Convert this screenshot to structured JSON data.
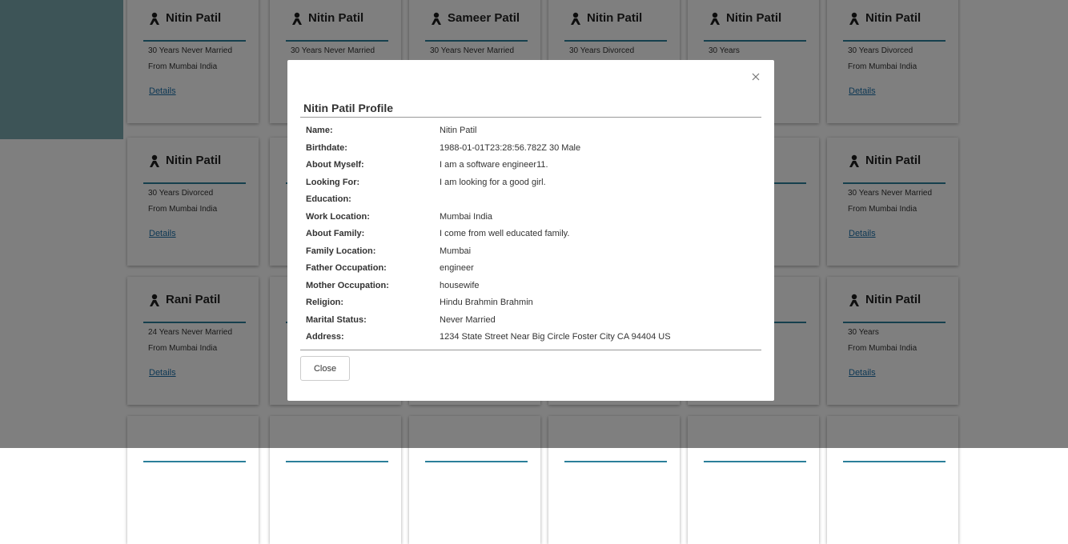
{
  "cards": [
    {
      "name": "Nitin Patil",
      "line1": "30 Years Never Married",
      "line2": "From Mumbai India",
      "link": "Details"
    },
    {
      "name": "Nitin Patil",
      "line1": "30 Years Never Married",
      "line2": "",
      "link": ""
    },
    {
      "name": "Sameer Patil",
      "line1": "30 Years Never Married",
      "line2": "",
      "link": ""
    },
    {
      "name": "Nitin Patil",
      "line1": "30 Years Divorced",
      "line2": "",
      "link": ""
    },
    {
      "name": "Nitin Patil",
      "line1": "30 Years",
      "line2": "",
      "link": ""
    },
    {
      "name": "Nitin Patil",
      "line1": "30 Years Divorced",
      "line2": "From Mumbai India",
      "link": "Details"
    },
    {
      "name": "Nitin Patil",
      "line1": "30 Years Divorced",
      "line2": "From Mumbai India",
      "link": "Details"
    },
    {
      "name": "",
      "line1": "",
      "line2": "",
      "link": ""
    },
    {
      "name": "",
      "line1": "",
      "line2": "",
      "link": ""
    },
    {
      "name": "",
      "line1": "",
      "line2": "",
      "link": ""
    },
    {
      "name": "il",
      "line1": "",
      "line2": "",
      "link": ""
    },
    {
      "name": "Nitin Patil",
      "line1": "30 Years Never Married",
      "line2": "From Mumbai India",
      "link": "Details"
    },
    {
      "name": "Rani Patil",
      "line1": "24 Years Never Married",
      "line2": "From Mumbai India",
      "link": "Details"
    },
    {
      "name": "",
      "line1": "",
      "line2": "",
      "link": ""
    },
    {
      "name": "",
      "line1": "",
      "line2": "",
      "link": ""
    },
    {
      "name": "",
      "line1": "",
      "line2": "",
      "link": ""
    },
    {
      "name": "il",
      "line1": "",
      "line2": "",
      "link": ""
    },
    {
      "name": "Nitin Patil",
      "line1": "30 Years",
      "line2": "From Mumbai India",
      "link": "Details"
    },
    {
      "name": "",
      "line1": "",
      "line2": "",
      "link": ""
    },
    {
      "name": "",
      "line1": "",
      "line2": "",
      "link": ""
    },
    {
      "name": "",
      "line1": "",
      "line2": "",
      "link": ""
    },
    {
      "name": "",
      "line1": "",
      "line2": "",
      "link": ""
    },
    {
      "name": "",
      "line1": "",
      "line2": "",
      "link": ""
    },
    {
      "name": "",
      "line1": "",
      "line2": "",
      "link": ""
    }
  ],
  "modal": {
    "title": "Nitin Patil Profile",
    "rows": [
      {
        "label": "Name:",
        "value": "Nitin Patil"
      },
      {
        "label": "Birthdate:",
        "value": "1988-01-01T23:28:56.782Z 30 Male"
      },
      {
        "label": "About Myself:",
        "value": "I am a software engineer11."
      },
      {
        "label": "Looking For:",
        "value": "I am looking for a good girl."
      },
      {
        "label": "Education:",
        "value": ""
      },
      {
        "label": "Work Location:",
        "value": "Mumbai India"
      },
      {
        "label": "About Family:",
        "value": "I come from well educated family."
      },
      {
        "label": "Family Location:",
        "value": "Mumbai"
      },
      {
        "label": "Father Occupation:",
        "value": "engineer"
      },
      {
        "label": "Mother Occupation:",
        "value": "housewife"
      },
      {
        "label": "Religion:",
        "value": "Hindu Brahmin Brahmin"
      },
      {
        "label": "Marital Status:",
        "value": "Never Married"
      },
      {
        "label": "Address:",
        "value": "1234 State Street Near Big Circle Foster City CA 94404 US"
      }
    ],
    "close_label": "Close"
  },
  "colors": {
    "accent": "#2b7f9a",
    "link": "#1a6fa8",
    "teal": "#7aa8ae"
  },
  "icons": {
    "card": "person-icon",
    "modal_close": "close-icon"
  }
}
